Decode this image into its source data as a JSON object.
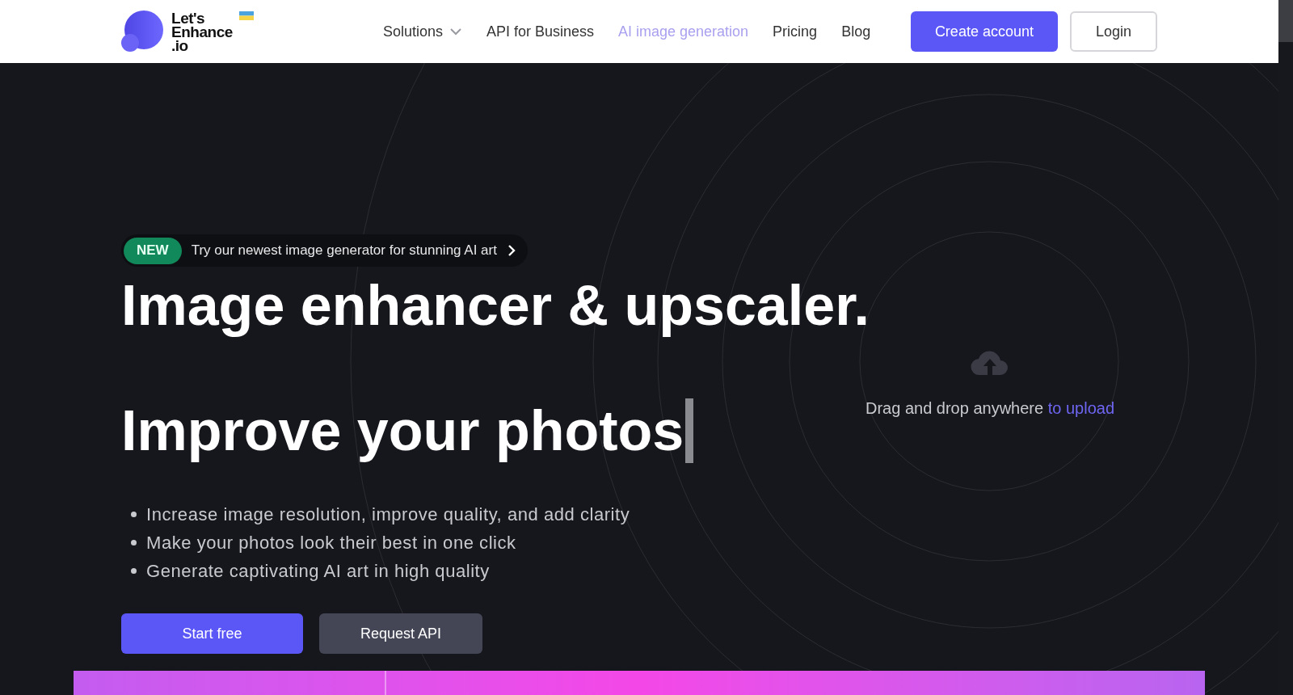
{
  "logo": {
    "lines": [
      "Let's",
      "Enhance",
      ".io"
    ]
  },
  "nav": [
    {
      "label": "Solutions",
      "dropdown": true,
      "selected": false
    },
    {
      "label": "API for Business",
      "dropdown": false,
      "selected": false
    },
    {
      "label": "AI image generation",
      "dropdown": false,
      "selected": true
    },
    {
      "label": "Pricing",
      "dropdown": false,
      "selected": false
    },
    {
      "label": "Blog",
      "dropdown": false,
      "selected": false
    }
  ],
  "header_buttons": [
    {
      "label": "Create account",
      "kind": "primary"
    },
    {
      "label": "Login",
      "kind": "outline"
    }
  ],
  "announcement": {
    "badge": "NEW",
    "text": "Try our newest image generator for stunning AI art"
  },
  "headline": [
    "Image enhancer & upscaler.",
    "Improve your photos"
  ],
  "bullets": [
    "Increase image resolution, improve quality, and add clarity",
    "Make your photos look their best in one click",
    "Generate captivating AI art in high quality"
  ],
  "hero_buttons": [
    {
      "label": "Start free",
      "kind": "primary"
    },
    {
      "label": "Request API",
      "kind": "secondary"
    }
  ],
  "upload": {
    "text": "Drag and drop anywhere",
    "link": "to upload"
  }
}
